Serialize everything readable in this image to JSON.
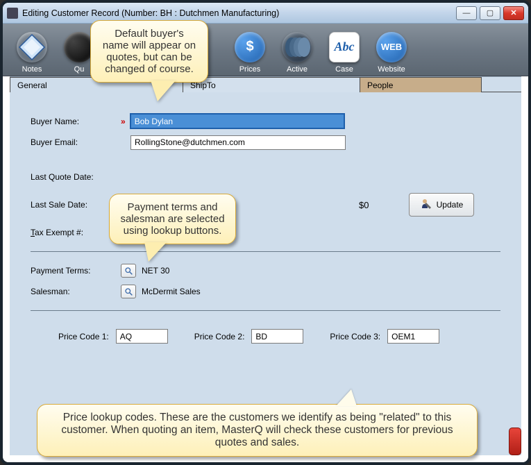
{
  "window": {
    "title": "Editing Customer Record  (Number: BH       :  Dutchmen Manufacturing)"
  },
  "toolbar": {
    "notes": "Notes",
    "qu": "Qu",
    "prices": "Prices",
    "active": "Active",
    "case": "Case",
    "website": "Website",
    "prices_glyph": "$",
    "case_glyph": "Abc",
    "web_glyph": "WEB"
  },
  "tabs": {
    "general": "General",
    "shipto": "ShipTo",
    "people": "People"
  },
  "form": {
    "buyer_name_label": "Buyer Name:",
    "buyer_name_value": "Bob Dylan",
    "buyer_email_label": "Buyer Email:",
    "buyer_email_value": "RollingStone@dutchmen.com",
    "last_quote_label": "Last Quote Date:",
    "last_sale_label": "Last Sale Date:",
    "last_sale_amount": "$0",
    "tax_exempt_label": "Tax Exempt #:",
    "update_label": "Update",
    "payment_terms_label": "Payment Terms:",
    "payment_terms_value": "NET 30",
    "salesman_label": "Salesman:",
    "salesman_value": "McDermit Sales",
    "price1_label": "Price Code 1:",
    "price1_value": "AQ",
    "price2_label": "Price Code 2:",
    "price2_value": "BD",
    "price3_label": "Price Code 3:",
    "price3_value": "OEM1",
    "required_marker": "»"
  },
  "callouts": {
    "c1": "Default buyer's name will appear on quotes, but can be changed of course.",
    "c2": "Payment terms and salesman are selected using lookup buttons.",
    "c3": "Price lookup codes.  These are the customers we identify as being \"related\" to this customer.  When quoting an item, MasterQ will check these customers for previous quotes and sales."
  }
}
